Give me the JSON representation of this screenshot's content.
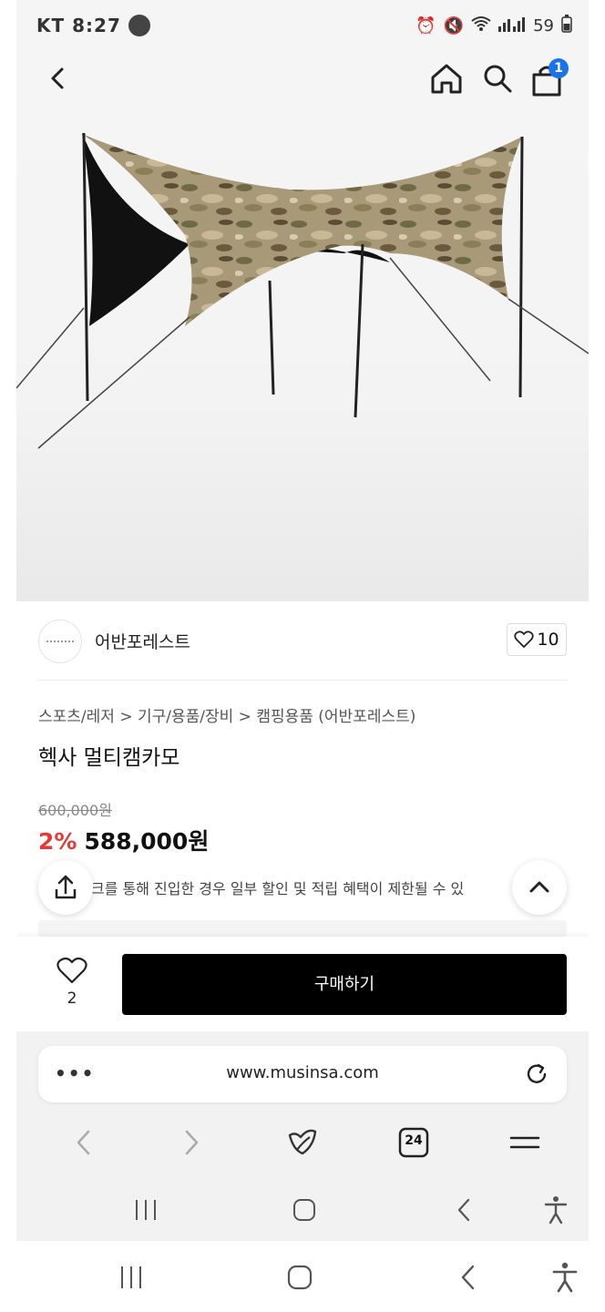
{
  "status": {
    "carrier": "KT",
    "time": "8:27",
    "battery": "59"
  },
  "header": {
    "cart_count": "1"
  },
  "brand": {
    "name": "어반포레스트",
    "likes": "10"
  },
  "product": {
    "breadcrumb": "스포츠/레저 > 기구/용품/장비 > 캠핑용품 (어반포레스트)",
    "title": "헥사 멀티캠카모",
    "original_price": "600,000원",
    "discount": "2%",
    "price": "588,000원",
    "notice": "크를 통해 진입한 경우 일부 할인 및 적립 혜택이 제한될 수 있"
  },
  "buy_bar": {
    "wish_count": "2",
    "buy_label": "구매하기"
  },
  "browser": {
    "url": "www.musinsa.com",
    "tabs_count": "24"
  }
}
